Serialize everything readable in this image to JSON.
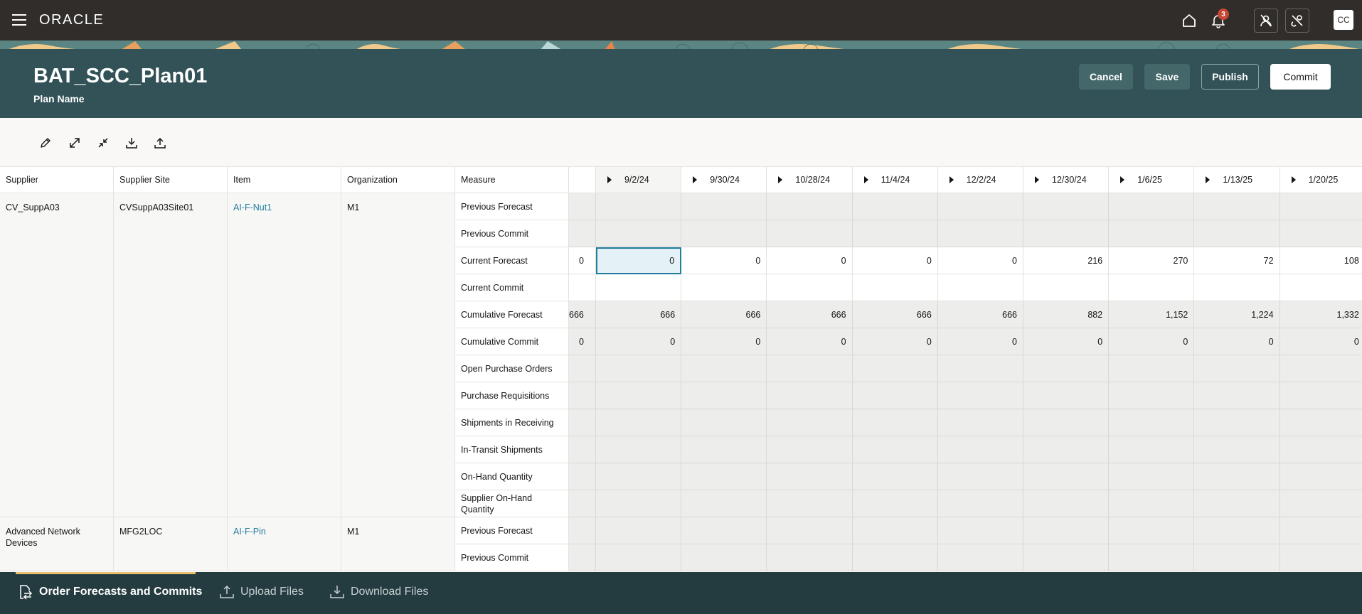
{
  "app": {
    "brand": "ORACLE",
    "notification_count": "3",
    "user_initials": "CC",
    "accent_color": "#227e9e",
    "header_color": "#325257"
  },
  "header": {
    "title": "BAT_SCC_Plan01",
    "subtitle": "Plan Name",
    "buttons": {
      "cancel": "Cancel",
      "save": "Save",
      "publish": "Publish",
      "commit": "Commit"
    }
  },
  "toolbar": {
    "icons": [
      "edit-icon",
      "expand-icon",
      "collapse-icon",
      "download-icon",
      "upload-icon"
    ]
  },
  "table": {
    "fixed_headers": [
      "Supplier",
      "Supplier Site",
      "Item",
      "Organization",
      "Measure"
    ],
    "date_headers": [
      "9/2/24",
      "9/30/24",
      "10/28/24",
      "11/4/24",
      "12/2/24",
      "12/30/24",
      "1/6/25",
      "1/13/25",
      "1/20/25"
    ],
    "groups": [
      {
        "supplier": "CV_SuppA03",
        "supplier_site": "CVSuppA03Site01",
        "item": "AI-F-Nut1",
        "organization": "M1",
        "measures": [
          {
            "name": "Previous Forecast",
            "lead": "",
            "values": [
              "",
              "",
              "",
              "",
              "",
              "",
              "",
              "",
              ""
            ]
          },
          {
            "name": "Previous Commit",
            "lead": "",
            "values": [
              "",
              "",
              "",
              "",
              "",
              "",
              "",
              "",
              ""
            ]
          },
          {
            "name": "Current Forecast",
            "lead": "0",
            "values": [
              "0",
              "0",
              "0",
              "0",
              "0",
              "216",
              "270",
              "72",
              "108"
            ]
          },
          {
            "name": "Current Commit",
            "lead": "",
            "values": [
              "",
              "",
              "",
              "",
              "",
              "",
              "",
              "",
              ""
            ]
          },
          {
            "name": "Cumulative Forecast",
            "lead": "666",
            "values": [
              "666",
              "666",
              "666",
              "666",
              "666",
              "882",
              "1,152",
              "1,224",
              "1,332"
            ]
          },
          {
            "name": "Cumulative Commit",
            "lead": "0",
            "values": [
              "0",
              "0",
              "0",
              "0",
              "0",
              "0",
              "0",
              "0",
              "0"
            ]
          },
          {
            "name": "Open Purchase Orders",
            "lead": "",
            "values": [
              "",
              "",
              "",
              "",
              "",
              "",
              "",
              "",
              ""
            ]
          },
          {
            "name": "Purchase Requisitions",
            "lead": "",
            "values": [
              "",
              "",
              "",
              "",
              "",
              "",
              "",
              "",
              ""
            ]
          },
          {
            "name": "Shipments in Receiving",
            "lead": "",
            "values": [
              "",
              "",
              "",
              "",
              "",
              "",
              "",
              "",
              ""
            ]
          },
          {
            "name": "In-Transit Shipments",
            "lead": "",
            "values": [
              "",
              "",
              "",
              "",
              "",
              "",
              "",
              "",
              ""
            ]
          },
          {
            "name": "On-Hand Quantity",
            "lead": "",
            "values": [
              "",
              "",
              "",
              "",
              "",
              "",
              "",
              "",
              ""
            ]
          },
          {
            "name": "Supplier On-Hand Quantity",
            "lead": "",
            "values": [
              "",
              "",
              "",
              "",
              "",
              "",
              "",
              "",
              ""
            ]
          }
        ]
      },
      {
        "supplier": "Advanced Network Devices",
        "supplier_site": "MFG2LOC",
        "item": "AI-F-Pin",
        "organization": "M1",
        "measures": [
          {
            "name": "Previous Forecast",
            "lead": "",
            "values": [
              "",
              "",
              "",
              "",
              "",
              "",
              "",
              "",
              ""
            ]
          },
          {
            "name": "Previous Commit",
            "lead": "",
            "values": [
              "",
              "",
              "",
              "",
              "",
              "",
              "",
              "",
              ""
            ]
          }
        ]
      }
    ]
  },
  "footer": {
    "tabs": [
      {
        "label": "Order Forecasts and Commits",
        "icon": "file-transfer-icon",
        "active": true
      },
      {
        "label": "Upload Files",
        "icon": "upload-icon",
        "active": false
      },
      {
        "label": "Download Files",
        "icon": "download-icon",
        "active": false
      }
    ]
  }
}
